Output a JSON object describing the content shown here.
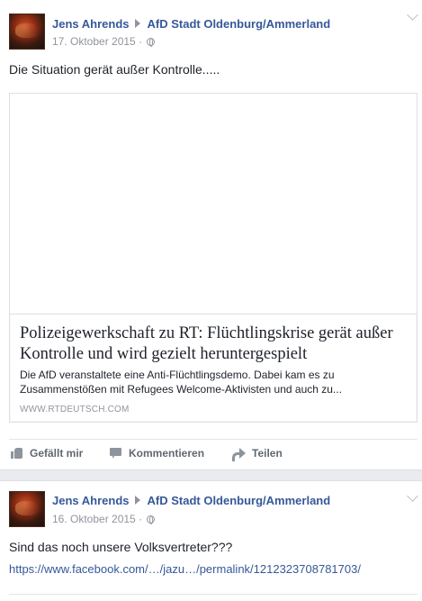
{
  "posts": [
    {
      "author": "Jens Ahrends",
      "page": "AfD Stadt Oldenburg/Ammerland",
      "date": "17. Oktober 2015",
      "separator": "·",
      "text": "Die Situation gerät außer Kontrolle.....",
      "link_card": {
        "title": "Polizeigewerkschaft zu RT: Flüchtlingskrise gerät außer Kontrolle und wird gezielt heruntergespielt",
        "description": "Die AfD veranstaltete eine Anti-Flüchtlingsdemo. Dabei kam es zu Zusammenstößen mit Refugees Welcome-Aktivisten und auch zu...",
        "domain": "WWW.RTDEUTSCH.COM"
      },
      "actions": {
        "like": "Gefällt mir",
        "comment": "Kommentieren",
        "share": "Teilen"
      }
    },
    {
      "author": "Jens Ahrends",
      "page": "AfD Stadt Oldenburg/Ammerland",
      "date": "16. Oktober 2015",
      "separator": "·",
      "text": "Sind das noch unsere Volksvertreter???",
      "link": "https://www.facebook.com/…/jazu…/permalink/1212323708781703/"
    }
  ],
  "icons": {
    "avatar": "profile-photo",
    "page_arrow": "triangle-right-icon",
    "privacy": "globe-icon",
    "menu": "chevron-down-icon",
    "like": "thumbs-up-icon",
    "comment": "comment-bubble-icon",
    "share": "share-arrow-icon"
  },
  "colors": {
    "link_blue": "#365899",
    "meta_gray": "#90949c",
    "action_gray": "#616770",
    "background": "#e9ebee"
  }
}
